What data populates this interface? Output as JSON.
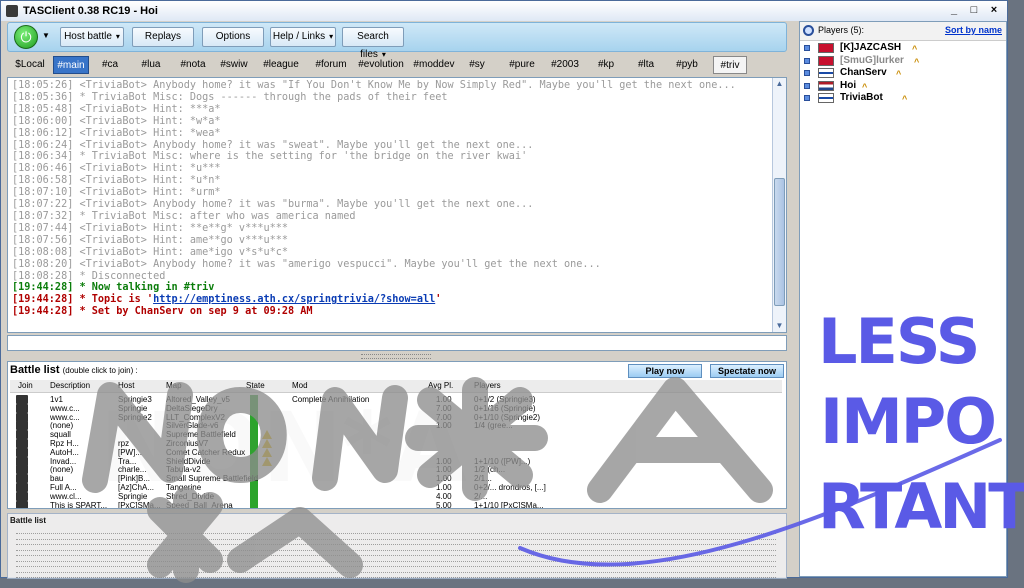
{
  "window": {
    "title": "TASClient 0.38 RC19 - Hoi",
    "controls": [
      "_",
      "□",
      "×"
    ]
  },
  "toolbar": {
    "buttons": [
      {
        "label": "Host battle",
        "has_caret": true
      },
      {
        "label": "Replays",
        "has_caret": false
      },
      {
        "label": "Options",
        "has_caret": false
      },
      {
        "label": "Help / Links",
        "has_caret": true
      },
      {
        "label": "Search files",
        "has_caret": true
      }
    ]
  },
  "tabs": [
    "$Local",
    "#main",
    "#ca",
    "#lua",
    "#nota",
    "#swiw",
    "#league",
    "#forum",
    "#evolution",
    "#moddev",
    "#sy",
    "#pure",
    "#2003",
    "#kp",
    "#lta",
    "#pyb",
    "#triv"
  ],
  "active_tab": "#main",
  "current_tab": "#triv",
  "chat": {
    "lines": [
      {
        "text": "[18:05:26] <TriviaBot> Anybody home? it was \"If You Don't Know Me by Now Simply Red\". Maybe you'll get the next one...",
        "kind": "grey"
      },
      {
        "text": "[18:05:36] * TriviaBot Misc: Dogs ------ through the pads of their feet",
        "kind": "grey"
      },
      {
        "text": "[18:05:48] <TriviaBot> Hint: ***a*",
        "kind": "grey"
      },
      {
        "text": "[18:06:00] <TriviaBot> Hint: *w*a*",
        "kind": "grey"
      },
      {
        "text": "[18:06:12] <TriviaBot> Hint: *wea*",
        "kind": "grey"
      },
      {
        "text": "[18:06:24] <TriviaBot> Anybody home? it was \"sweat\". Maybe you'll get the next one...",
        "kind": "grey"
      },
      {
        "text": "[18:06:34] * TriviaBot Misc: where is the setting for 'the bridge on the river kwai'",
        "kind": "grey"
      },
      {
        "text": "[18:06:46] <TriviaBot> Hint: *u***",
        "kind": "grey"
      },
      {
        "text": "[18:06:58] <TriviaBot> Hint: *u*n*",
        "kind": "grey"
      },
      {
        "text": "[18:07:10] <TriviaBot> Hint: *urm*",
        "kind": "grey"
      },
      {
        "text": "[18:07:22] <TriviaBot> Anybody home? it was \"burma\". Maybe you'll get the next one...",
        "kind": "grey"
      },
      {
        "text": "[18:07:32] * TriviaBot Misc: after who was america named",
        "kind": "grey"
      },
      {
        "text": "[18:07:44] <TriviaBot> Hint: **e**g* v***u***",
        "kind": "grey"
      },
      {
        "text": "[18:07:56] <TriviaBot> Hint: ame**go v***u***",
        "kind": "grey"
      },
      {
        "text": "[18:08:08] <TriviaBot> Hint: ame*igo v*s*u*c*",
        "kind": "grey"
      },
      {
        "text": "[18:08:20] <TriviaBot> Anybody home? it was \"amerigo vespucci\". Maybe you'll get the next one...",
        "kind": "grey"
      },
      {
        "text": "[18:08:28] * Disconnected",
        "kind": "grey"
      },
      {
        "text": "[19:44:28] * Now talking in #triv",
        "kind": "green"
      },
      {
        "text": "[19:44:28] * Topic is '",
        "kind": "red",
        "link": "http://emptiness.ath.cx/springtrivia/?show=all",
        "after": "'"
      },
      {
        "text": "[19:44:28] * Set by ChanServ on sep 9 at 09:28 AM",
        "kind": "red"
      }
    ]
  },
  "battle_list": {
    "title": "Battle list",
    "hint": "(double click to join) :",
    "play_now": "Play now",
    "spectate_now": "Spectate now",
    "columns": [
      "Join",
      "Description",
      "Host",
      "Map",
      "State",
      "Mod",
      "Avg Pl.",
      "Players"
    ],
    "rows": [
      {
        "desc": "1v1",
        "host": "Springie3",
        "map": "Altored_Valley_v5",
        "mod": "Complete Annihilation",
        "avg": "1.00",
        "players": "0+1/2 (Springie3)"
      },
      {
        "desc": "www.c...",
        "host": "Springie",
        "map": "DeltaSiegeDry",
        "mod": "",
        "avg": "7.00",
        "players": "0+1/16 (Springie)"
      },
      {
        "desc": "www.c...",
        "host": "Springie2",
        "map": "LLT_ComplexV2",
        "mod": "",
        "avg": "7.00",
        "players": "0+1/10 (Springie2)"
      },
      {
        "desc": "(none)",
        "host": "",
        "map": "SilverGlade-v6",
        "mod": "",
        "avg": "1.00",
        "players": "1/4 (gree..."
      },
      {
        "desc": "squall",
        "host": "",
        "map": "Supreme Battlefield",
        "mod": "",
        "avg": "",
        "players": ""
      },
      {
        "desc": "Rpz H...",
        "host": "rpz",
        "map": "ZirconiusV7",
        "mod": "",
        "avg": "",
        "players": ""
      },
      {
        "desc": "AutoH...",
        "host": "[PW]...",
        "map": "Comet Catcher Redux",
        "mod": "",
        "avg": "",
        "players": ""
      },
      {
        "desc": "Invad...",
        "host": "Tra...",
        "map": "ShieldDivide",
        "mod": "",
        "avg": "1.00",
        "players": "1+1/10 ([PW]...)"
      },
      {
        "desc": "(none)",
        "host": "charle...",
        "map": "Tabula-v2",
        "mod": "",
        "avg": "1.00",
        "players": "1/2 (ch..."
      },
      {
        "desc": "bau",
        "host": "[Pink]B...",
        "map": "Small Supreme Battlefield",
        "mod": "",
        "avg": "1.00",
        "players": "2/1..."
      },
      {
        "desc": "Full A...",
        "host": "[Az]ChA...",
        "map": "Tangerine",
        "mod": "",
        "avg": "1.00",
        "players": "0+2/...  drondros, [...]"
      },
      {
        "desc": "www.cl...",
        "host": "Springie",
        "map": "Shred_Divide",
        "mod": "",
        "avg": "4.00",
        "players": "2/..."
      },
      {
        "desc": "This is SPART...",
        "host": "[PxC]SMa...",
        "map": "Speed_Ball_Arena",
        "mod": "",
        "avg": "5.00",
        "players": "1+1/10 [PxC]SMa..."
      }
    ]
  },
  "players": {
    "title": "Players (5):",
    "sort_label": "Sort by name",
    "list": [
      {
        "name": "[K]JAZCASH",
        "flag": "gb",
        "dim": false
      },
      {
        "name": "[SmuG]lurker",
        "flag": "gb",
        "dim": true
      },
      {
        "name": "ChanServ",
        "flag": "fi",
        "dim": false
      },
      {
        "name": "Hoi",
        "flag": "nl",
        "dim": false
      },
      {
        "name": "TriviaBot",
        "flag": "fi",
        "dim": false
      }
    ]
  },
  "annotations": {
    "scribble_left": "NON*A",
    "scribble_right_1": "LESS",
    "scribble_right_2": "IMPO",
    "scribble_right_3": "RTANT"
  }
}
